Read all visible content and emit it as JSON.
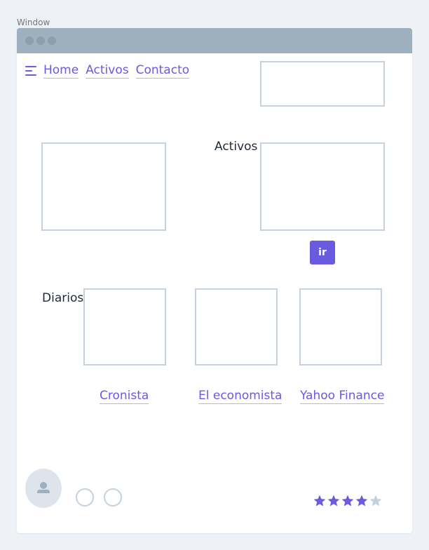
{
  "window_label": "Window",
  "nav": {
    "items": [
      "Home",
      "Activos",
      "Contacto"
    ]
  },
  "activos_label": "Activos",
  "ir_button": "ir",
  "diarios_label": "Diarios",
  "diarios": [
    "Cronista",
    "El economista",
    "Yahoo Finance"
  ],
  "rating": {
    "value": 4,
    "max": 5
  },
  "colors": {
    "accent": "#6a5ae0",
    "titlebar": "#9eafbd",
    "placeholder_border": "#c5d2de",
    "star_empty": "#c5d2de"
  },
  "icons": {
    "menu": "hamburger-icon",
    "avatar": "user-icon",
    "rating": "star-icon"
  }
}
